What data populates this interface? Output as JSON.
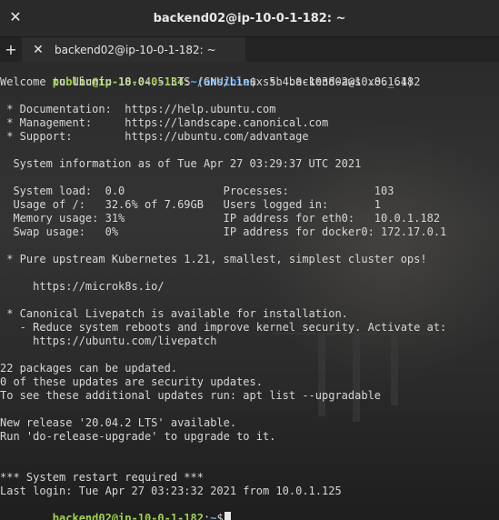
{
  "window": {
    "title": "backend02@ip-10-0-1-182: ~"
  },
  "tabs": [
    {
      "label": "backend02@ip-10-0-1-182: ~"
    }
  ],
  "terminal": {
    "prompt1": {
      "user_host": "public@ip-10-0-0-134",
      "separator": ":",
      "path": "~/ansible",
      "symbol": "$",
      "command": " ssh backend02@10.0.1.182"
    },
    "lines": [
      "Welcome to Ubuntu 18.04.5 LTS (GNU/Linux 5.4.0-1038-aws x86_64)",
      "",
      " * Documentation:  https://help.ubuntu.com",
      " * Management:     https://landscape.canonical.com",
      " * Support:        https://ubuntu.com/advantage",
      "",
      "  System information as of Tue Apr 27 03:29:37 UTC 2021",
      "",
      "  System load:  0.0               Processes:             103",
      "  Usage of /:   32.6% of 7.69GB   Users logged in:       1",
      "  Memory usage: 31%               IP address for eth0:   10.0.1.182",
      "  Swap usage:   0%                IP address for docker0: 172.17.0.1",
      "",
      " * Pure upstream Kubernetes 1.21, smallest, simplest cluster ops!",
      "",
      "     https://microk8s.io/",
      "",
      " * Canonical Livepatch is available for installation.",
      "   - Reduce system reboots and improve kernel security. Activate at:",
      "     https://ubuntu.com/livepatch",
      "",
      "22 packages can be updated.",
      "0 of these updates are security updates.",
      "To see these additional updates run: apt list --upgradable",
      "",
      "New release '20.04.2 LTS' available.",
      "Run 'do-release-upgrade' to upgrade to it.",
      "",
      "",
      "*** System restart required ***",
      "Last login: Tue Apr 27 03:23:32 2021 from 10.0.1.125"
    ],
    "prompt2": {
      "user_host": "backend02@ip-10-0-1-182",
      "separator": ":",
      "path": "~",
      "symbol": "$"
    }
  },
  "colors": {
    "user_prompt": "#9ed44a",
    "path_prompt": "#58a8ff",
    "text": "#d7d7d7"
  }
}
